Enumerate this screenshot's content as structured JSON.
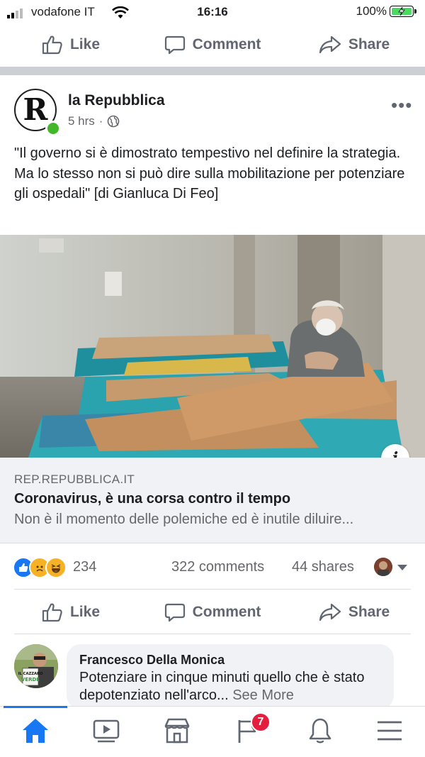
{
  "status_bar": {
    "carrier": "vodafone IT",
    "time": "16:16",
    "battery": "100%",
    "battery_level": 1.0
  },
  "top_actions": {
    "like": "Like",
    "comment": "Comment",
    "share": "Share"
  },
  "post": {
    "page_name": "la Repubblica",
    "logo_letter": "R",
    "time": "5 hrs",
    "separator": "·",
    "privacy_icon": "globe-icon",
    "text": "\"Il governo si è dimostrato tempestivo nel definire la strategia. Ma lo stesso non si può dire sulla mobilitazione per potenziare gli ospedali\" [di Gianluca Di Feo]",
    "link": {
      "domain": "REP.REPUBBLICA.IT",
      "title": "Coronavirus, è una corsa contro il tempo",
      "description": "Non è il momento delle polemiche ed è inutile diluire..."
    },
    "stats": {
      "reaction_count": "234",
      "comments": "322 comments",
      "shares": "44 shares"
    },
    "actions": {
      "like": "Like",
      "comment": "Comment",
      "share": "Share"
    }
  },
  "comment": {
    "author": "Francesco Della Monica",
    "text": "Potenziare in cinque minuti quello che è stato depotenziato nell'arco...",
    "see_more": "See More",
    "avatar_text_1": "IL CAZZARO",
    "avatar_text_2": "VERDE"
  },
  "tabbar": {
    "items": [
      "home-icon",
      "watch-icon",
      "marketplace-icon",
      "pages-flag-icon",
      "notifications-bell-icon",
      "menu-icon"
    ],
    "badge": "7"
  },
  "colors": {
    "accent": "#1877f2",
    "badge": "#e41e3f",
    "online": "#42b72a"
  }
}
